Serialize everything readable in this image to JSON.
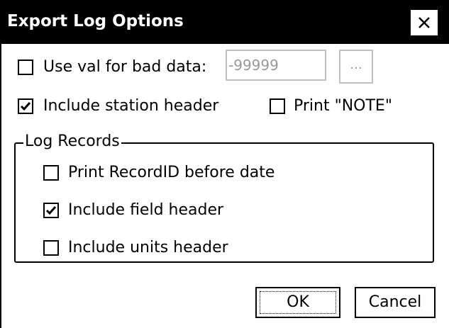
{
  "window": {
    "title": "Export Log Options",
    "close_icon": "close-icon"
  },
  "options": {
    "use_val_label": "Use val for bad data:",
    "use_val_checked": false,
    "bad_data_value": "-99999",
    "browse_button": "...",
    "include_station_header_label": "Include station header",
    "include_station_header_checked": true,
    "print_note_label": "Print \"NOTE\"",
    "print_note_checked": false
  },
  "log_records": {
    "group_label": "Log Records",
    "print_recordid_label": "Print RecordID before date",
    "print_recordid_checked": false,
    "include_field_header_label": "Include field header",
    "include_field_header_checked": true,
    "include_units_header_label": "Include units header",
    "include_units_header_checked": false
  },
  "buttons": {
    "ok": "OK",
    "cancel": "Cancel"
  }
}
